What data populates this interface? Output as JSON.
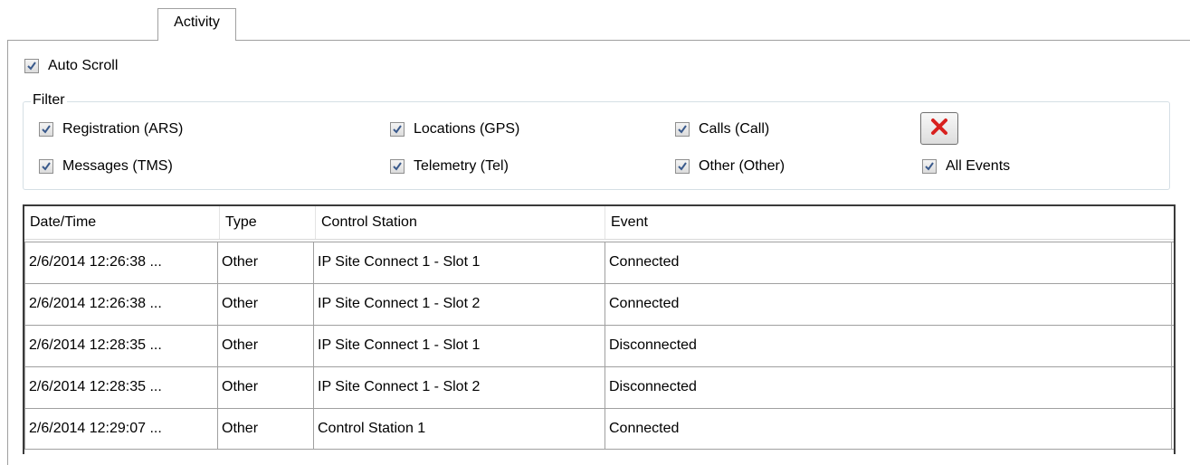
{
  "tabs": [
    {
      "label": "Activity"
    }
  ],
  "auto_scroll": {
    "label": "Auto Scroll",
    "checked": true
  },
  "filter": {
    "legend": "Filter",
    "options": [
      {
        "label": "Registration (ARS)",
        "checked": true
      },
      {
        "label": "Locations (GPS)",
        "checked": true
      },
      {
        "label": "Calls (Call)",
        "checked": true
      },
      {
        "label": "Messages (TMS)",
        "checked": true
      },
      {
        "label": "Telemetry (Tel)",
        "checked": true
      },
      {
        "label": "Other (Other)",
        "checked": true
      },
      {
        "label": "All Events",
        "checked": true
      }
    ],
    "clear_icon": "red-x-icon"
  },
  "grid": {
    "columns": [
      "Date/Time",
      "Type",
      "Control Station",
      "Event"
    ],
    "rows": [
      [
        "2/6/2014 12:26:38 ...",
        "Other",
        "IP Site Connect 1 - Slot 1",
        "Connected"
      ],
      [
        "2/6/2014 12:26:38 ...",
        "Other",
        "IP Site Connect 1 - Slot 2",
        "Connected"
      ],
      [
        "2/6/2014 12:28:35 ...",
        "Other",
        "IP Site Connect 1 - Slot 1",
        "Disconnected"
      ],
      [
        "2/6/2014 12:28:35 ...",
        "Other",
        "IP Site Connect 1 - Slot 2",
        "Disconnected"
      ],
      [
        "2/6/2014 12:29:07 ...",
        "Other",
        "Control Station 1",
        "Connected"
      ]
    ]
  },
  "colors": {
    "check": "#3a5a8c",
    "clear_x": "#d8201e"
  }
}
